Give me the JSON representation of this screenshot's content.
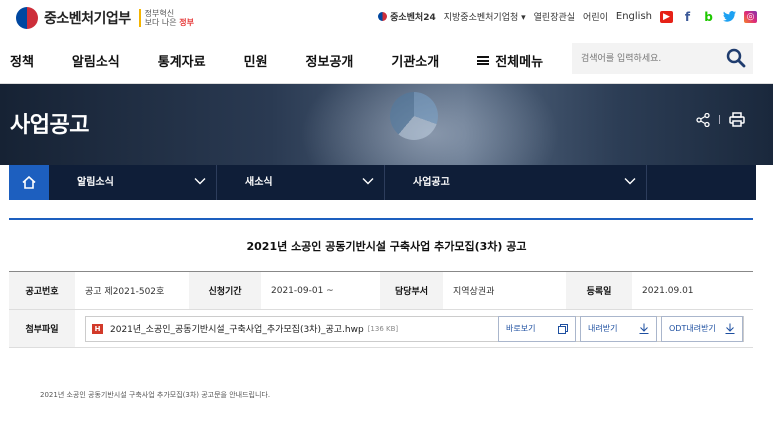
{
  "header": {
    "logo_text": "중소벤처기업부",
    "slogan_top": "정부혁신",
    "slogan_main": "보다 나은",
    "slogan_end": "정부",
    "util_links": [
      "중소벤처24",
      "지방중소벤처기업청 ▾",
      "열린장관실",
      "어린이",
      "English"
    ],
    "sns": [
      {
        "name": "youtube-icon",
        "glyph": "▶"
      },
      {
        "name": "facebook-icon",
        "glyph": "f"
      },
      {
        "name": "blog-icon",
        "glyph": "b"
      },
      {
        "name": "twitter-icon",
        "glyph": "🐦"
      },
      {
        "name": "instagram-icon",
        "glyph": "◎"
      }
    ]
  },
  "nav": {
    "items": [
      "정책",
      "알림소식",
      "통계자료",
      "민원",
      "정보공개",
      "기관소개",
      "전체메뉴"
    ],
    "search_placeholder": "검색어를 입력하세요."
  },
  "hero": {
    "title": "사업공고"
  },
  "location": {
    "level1": "알림소식",
    "level2": "새소식",
    "level3": "사업공고"
  },
  "article": {
    "title": "2021년 소공인 공동기반시설 구축사업 추가모집(3차) 공고",
    "labels": {
      "notice_no": "공고번호",
      "apply_period": "신청기간",
      "dept": "담당부서",
      "reg_date": "등록일",
      "attachment": "첨부파일"
    },
    "values": {
      "notice_no": "공고 제2021-502호",
      "apply_period": "2021-09-01 ~",
      "dept": "지역상권과",
      "reg_date": "2021.09.01"
    },
    "file": {
      "name": "2021년_소공인_공동기반시설_구축사업_추가모집(3차)_공고.hwp",
      "size": "[136 KB]",
      "type_badge": "H"
    },
    "buttons": {
      "preview": "바로보기",
      "download": "내려받기",
      "odt": "ODT내려받기"
    },
    "body": "2021년 소공인 공동기반시설 구축사업 추가모집(3차) 공고문을 안내드립니다."
  },
  "colors": {
    "accent": "#1d5fbf",
    "location_bar": "#0f1e38"
  }
}
